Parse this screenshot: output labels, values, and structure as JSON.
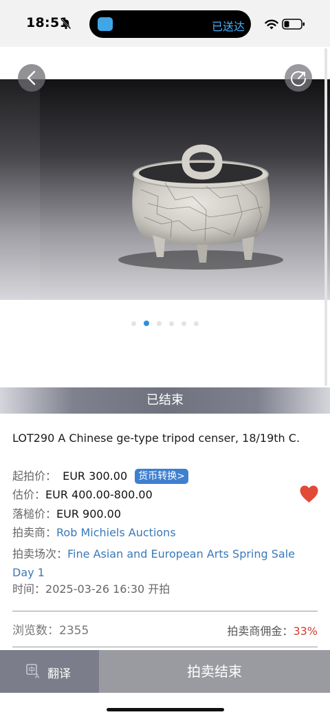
{
  "status_bar": {
    "time": "18:51",
    "island_text": "已送达",
    "icons": [
      "bell-muted-icon",
      "wifi-icon",
      "battery-icon"
    ]
  },
  "gallery": {
    "image_description_icon": "tripod-censer-photo",
    "page_count": 6,
    "active_page": 2
  },
  "status_banner": {
    "text": "已结束"
  },
  "lot": {
    "title": "LOT290 A Chinese ge-type tripod censer, 18/19th C.",
    "start_price_label": "起拍价：",
    "start_price": "EUR 300.00",
    "currency_convert": "货币转换>",
    "estimate_label": "估价：",
    "estimate": "EUR 400.00-800.00",
    "hammer_label": "落槌价：",
    "hammer": "EUR 900.00",
    "auctioneer_label": "拍卖商：",
    "auctioneer": "Rob Michiels Auctions",
    "session_label": "拍卖场次：",
    "session": "Fine Asian and European Arts Spring Sale Day 1",
    "time_label": "时间：",
    "time": "2025-03-26 16:30 开拍"
  },
  "stats": {
    "views_label": "浏览数：",
    "views": "2355",
    "commission_label": "拍卖商佣金：",
    "commission": "33%"
  },
  "actions": {
    "translate": "翻译",
    "auction_ended": "拍卖结束"
  },
  "colors": {
    "accent": "#3f7fd0",
    "link": "#3a78b8",
    "heart": "#e04a36",
    "commission": "#d23c2a"
  }
}
